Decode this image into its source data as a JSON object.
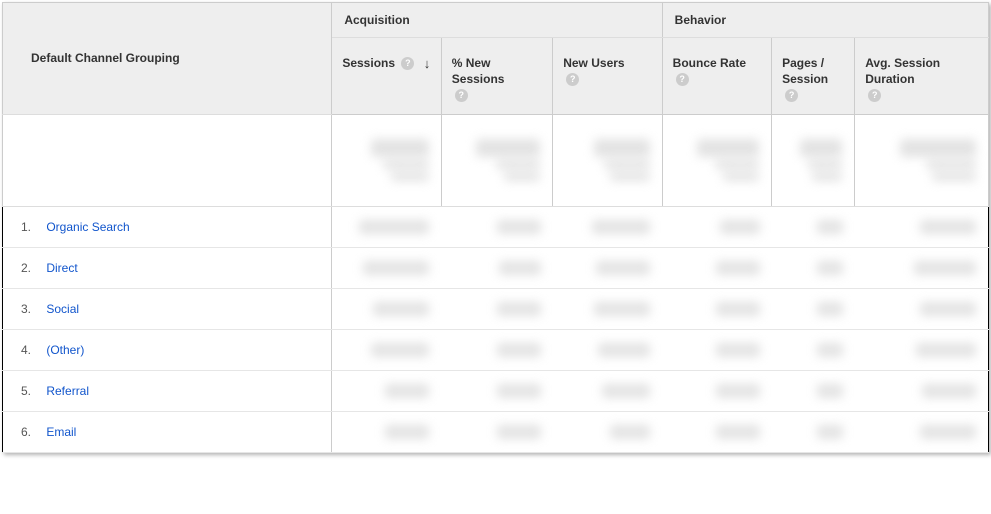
{
  "dimension_header": "Default Channel Grouping",
  "groups": {
    "acquisition": "Acquisition",
    "behavior": "Behavior"
  },
  "metrics": {
    "sessions": "Sessions",
    "pct_new_sessions": "% New Sessions",
    "new_users": "New Users",
    "bounce_rate": "Bounce Rate",
    "pages_session": "Pages / Session",
    "avg_session_duration": "Avg. Session Duration"
  },
  "help_glyph": "?",
  "sort_glyph": "↓",
  "rows": [
    {
      "num": "1.",
      "label": "Organic Search"
    },
    {
      "num": "2.",
      "label": "Direct"
    },
    {
      "num": "3.",
      "label": "Social"
    },
    {
      "num": "4.",
      "label": "(Other)"
    },
    {
      "num": "5.",
      "label": "Referral"
    },
    {
      "num": "6.",
      "label": "Email"
    }
  ]
}
